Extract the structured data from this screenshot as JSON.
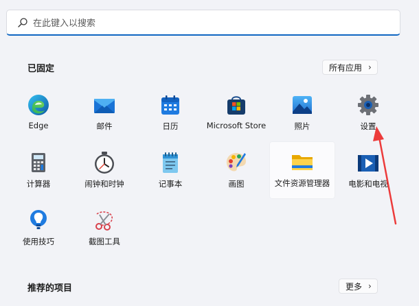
{
  "search": {
    "placeholder": "在此键入以搜索",
    "icon": "search-icon"
  },
  "pinned": {
    "title": "已固定",
    "all_apps_button": "所有应用",
    "apps": [
      {
        "label": "Edge",
        "icon": "edge-icon"
      },
      {
        "label": "邮件",
        "icon": "mail-icon"
      },
      {
        "label": "日历",
        "icon": "calendar-icon"
      },
      {
        "label": "Microsoft Store",
        "icon": "store-icon"
      },
      {
        "label": "照片",
        "icon": "photos-icon"
      },
      {
        "label": "设置",
        "icon": "settings-gear-icon"
      },
      {
        "label": "计算器",
        "icon": "calculator-icon"
      },
      {
        "label": "闹钟和时钟",
        "icon": "alarm-clock-icon"
      },
      {
        "label": "记事本",
        "icon": "notepad-icon"
      },
      {
        "label": "画图",
        "icon": "paint-palette-icon"
      },
      {
        "label": "文件资源管理器",
        "icon": "file-explorer-folder-icon"
      },
      {
        "label": "电影和电视",
        "icon": "movies-tv-icon"
      },
      {
        "label": "使用技巧",
        "icon": "tips-lightbulb-icon"
      },
      {
        "label": "截图工具",
        "icon": "snipping-tool-icon"
      }
    ]
  },
  "recommended": {
    "title": "推荐的项目",
    "more_button": "更多"
  },
  "colors": {
    "accent": "#0f66c2",
    "background": "#f2f3f7",
    "annotation_arrow": "#ec3b3b"
  }
}
